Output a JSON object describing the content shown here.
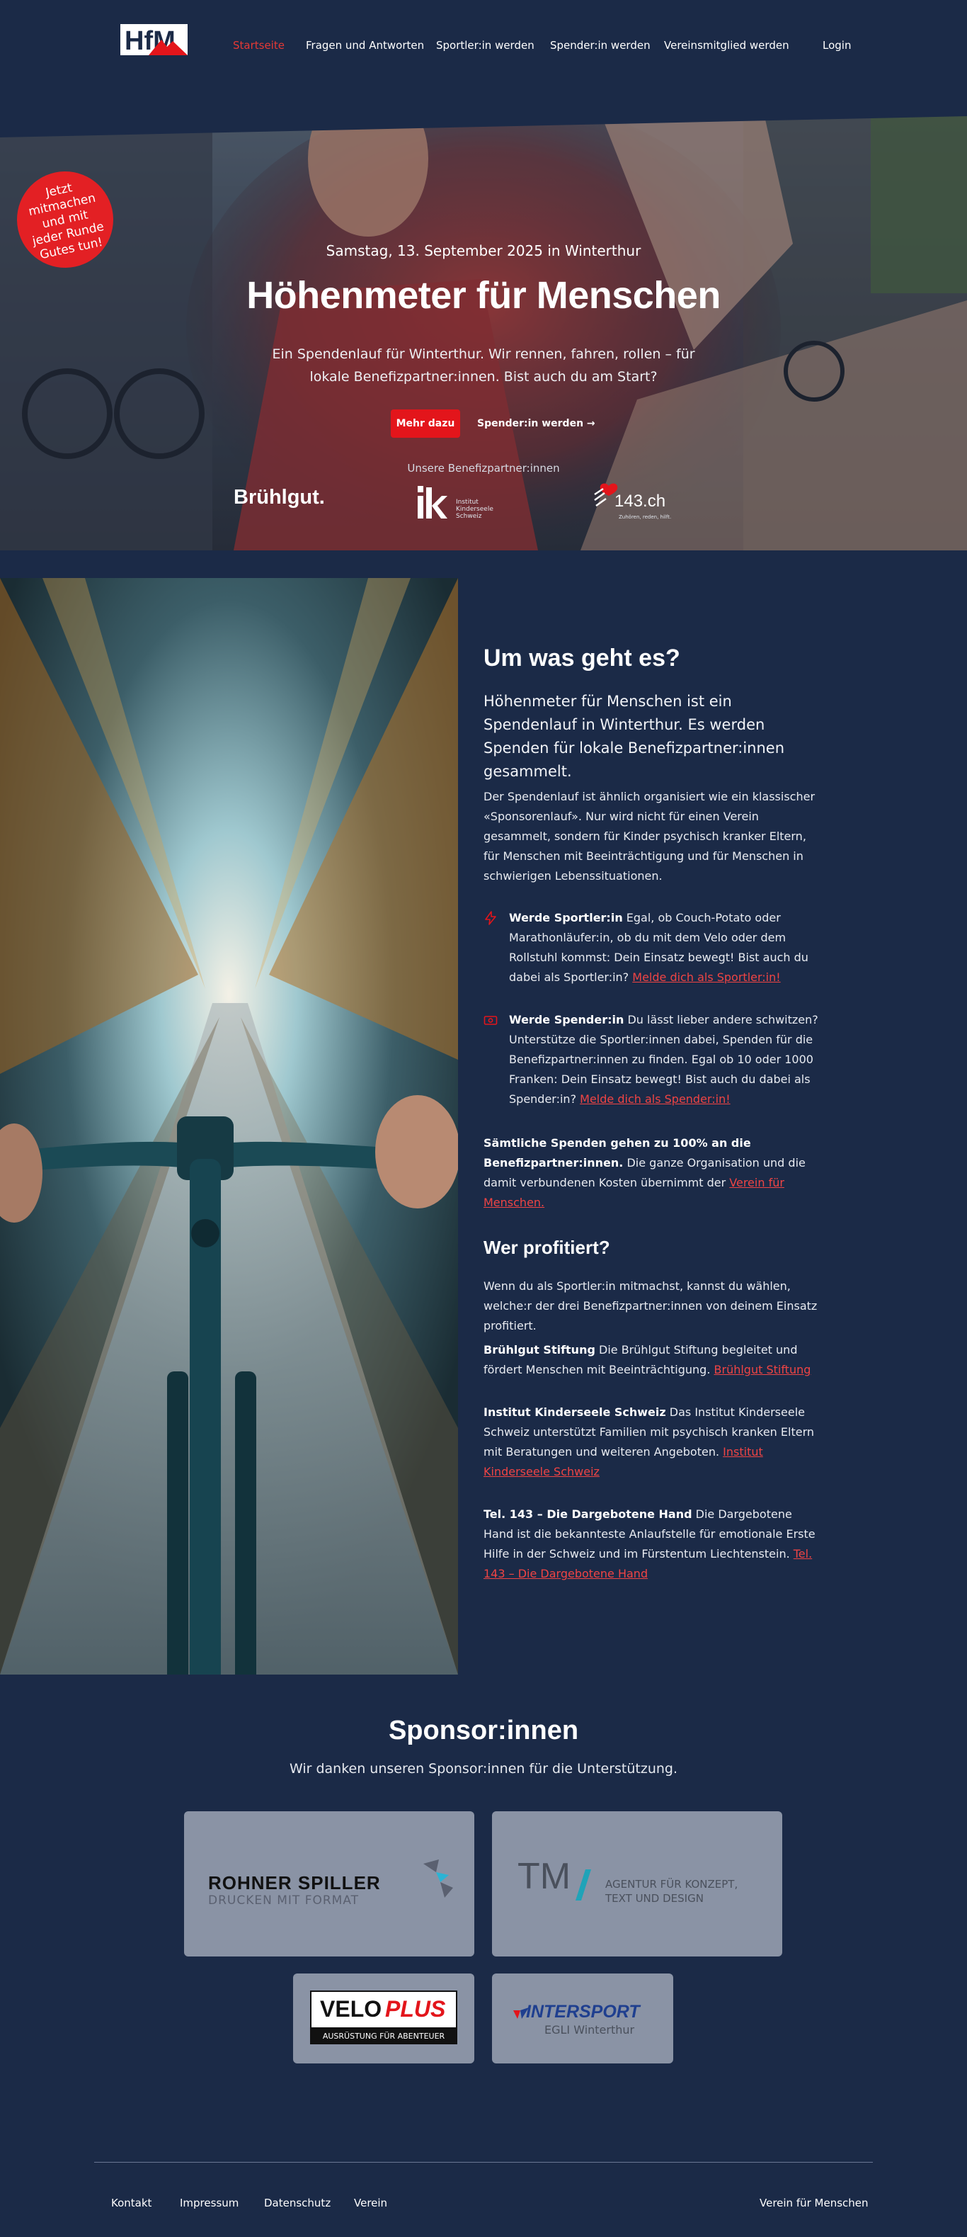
{
  "header": {
    "logo_alt": "HfM",
    "nav": [
      {
        "label": "Startseite",
        "active": true
      },
      {
        "label": "Fragen und Antworten",
        "active": false
      },
      {
        "label": "Sportler:in werden",
        "active": false
      },
      {
        "label": "Spender:in werden",
        "active": false
      },
      {
        "label": "Vereinsmitglied werden",
        "active": false
      },
      {
        "label": "Login",
        "active": false
      }
    ]
  },
  "hero": {
    "badge": "Jetzt mitmachen und mit jeder Runde Gutes tun!",
    "date": "Samstag, 13. September 2025 in Winterthur",
    "title": "Höhenmeter für Menschen",
    "subtitle": "Ein Spendenlauf für Winterthur. Wir rennen, fahren, rollen – für lokale Benefizpartner:innen. Bist auch du am Start?",
    "primary_button": "Mehr dazu",
    "secondary_button": "Spender:in werden →",
    "partners_label": "Unsere Benefizpartner:innen",
    "partners": [
      {
        "name": "Brühlgut."
      },
      {
        "name": "IKS",
        "line1": "Institut",
        "line2": "Kinderseele",
        "line3": "Schweiz"
      },
      {
        "name": "143.ch",
        "tagline": "Zuhören, reden, hilft."
      }
    ]
  },
  "about": {
    "title": "Um was geht es?",
    "lead": "Höhenmeter für Menschen ist ein Spendenlauf in Winterthur. Es werden Spenden für lokale Benefizpartner:innen gesammelt.",
    "intro": "Der Spendenlauf ist ähnlich organisiert wie ein klassischer «Sponsorenlauf». Nur wird nicht für einen Verein gesammelt, sondern für Kinder psychisch kranker Eltern, für Menschen mit Beeinträchtigung und für Menschen in schwierigen Lebenssituationen.",
    "features": [
      {
        "icon": "lightning-icon",
        "title": "Werde Sportler:in",
        "text": " Egal, ob Couch-Potato oder Marathonläufer:in, ob du mit dem Velo oder dem Rollstuhl kommst: Dein Einsatz bewegt! Bist auch du dabei als Sportler:in? ",
        "link": "Melde dich als Sportler:in!"
      },
      {
        "icon": "banknote-icon",
        "title": "Werde Spender:in",
        "text": " Du lässt lieber andere schwitzen? Unterstütze die Sportler:innen dabei, Spenden für die Benefizpartner:innen zu finden. Egal ob 10 oder 1000 Franken: Dein Einsatz bewegt! Bist auch du dabei als Spender:in? ",
        "link": "Melde dich als Spender:in!"
      }
    ],
    "note_bold": "Sämtliche Spenden gehen zu 100% an die Benefizpartner:innen.",
    "note_text": " Die ganze Organisation und die damit verbundenen Kosten übernimmt der ",
    "note_link": "Verein für Menschen.",
    "who_title": "Wer profitiert?",
    "who_intro": "Wenn du als Sportler:in mitmachst, kannst du wählen, welche:r der drei Benefizpartner:innen von deinem Einsatz profitiert.",
    "beneficiaries": [
      {
        "name": "Brühlgut Stiftung",
        "text": " Die Brühlgut Stiftung begleitet und fördert Menschen mit Beeinträchtigung. ",
        "link": "Brühlgut Stiftung"
      },
      {
        "name": "Institut Kinderseele Schweiz",
        "text": " Das Institut Kinderseele Schweiz unterstützt Familien mit psychisch kranken Eltern mit Beratungen und weiteren Angeboten. ",
        "link": "Institut Kinderseele Schweiz"
      },
      {
        "name": "Tel. 143 – Die Dargebotene Hand",
        "text": " Die Dargebotene Hand ist die bekannteste Anlaufstelle für emotionale Erste Hilfe in der Schweiz und im Fürstentum Liechtenstein. ",
        "link": "Tel. 143 – Die Dargebotene Hand"
      }
    ]
  },
  "sponsors": {
    "title": "Sponsor:innen",
    "subtitle": "Wir danken unseren Sponsor:innen für die Unterstützung.",
    "items": [
      {
        "name": "ROHNER SPILLER",
        "tagline": "DRUCKEN MIT FORMAT"
      },
      {
        "name": "TM",
        "tagline1": "AGENTUR FÜR KONZEPT,",
        "tagline2": "TEXT UND DESIGN"
      },
      {
        "name_a": "VELO",
        "name_b": "PLUS",
        "tagline": "AUSRÜSTUNG FÜR ABENTEUER"
      },
      {
        "name": "INTERSPORT",
        "tagline": "EGLI Winterthur"
      }
    ]
  },
  "footer": {
    "links": [
      "Kontakt",
      "Impressum",
      "Datenschutz",
      "Verein"
    ],
    "right": "Verein für Menschen"
  },
  "colors": {
    "background": "#1b2a47",
    "accent": "#e3151b",
    "card": "#8a93a5"
  }
}
